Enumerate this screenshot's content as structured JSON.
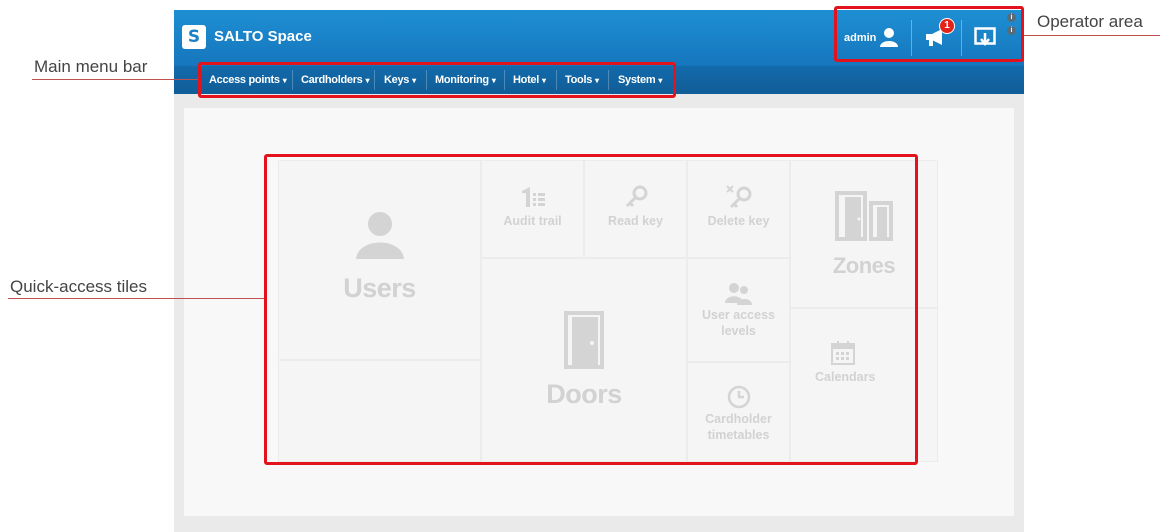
{
  "app": {
    "logo_letter": "S",
    "title": "SALTO Space"
  },
  "operator": {
    "username": "admin",
    "notification_count": "1",
    "info_glyph": "i",
    "icons": [
      "user-icon",
      "megaphone-icon",
      "logout-icon",
      "info-icon"
    ]
  },
  "menu": {
    "caret": "▾",
    "items": [
      {
        "label": "Access points"
      },
      {
        "label": "Cardholders"
      },
      {
        "label": "Keys"
      },
      {
        "label": "Monitoring"
      },
      {
        "label": "Hotel"
      },
      {
        "label": "Tools"
      },
      {
        "label": "System"
      }
    ]
  },
  "tiles": {
    "users": "Users",
    "audit_trail": "Audit trail",
    "read_key": "Read key",
    "delete_key": "Delete key",
    "zones": "Zones",
    "doors": "Doors",
    "user_access_levels_line1": "User access",
    "user_access_levels_line2": "levels",
    "calendars": "Calendars",
    "cardholder_timetables_line1": "Cardholder",
    "cardholder_timetables_line2": "timetables"
  },
  "annotations": {
    "operator_area": "Operator area",
    "main_menu_bar": "Main menu bar",
    "quick_access_tiles": "Quick-access tiles"
  },
  "colors": {
    "header_blue": "#1a82c8",
    "menu_blue": "#136aab",
    "callout_red": "#e2131d",
    "badge_red": "#e2231a",
    "tile_text": "#d2d2d2"
  }
}
